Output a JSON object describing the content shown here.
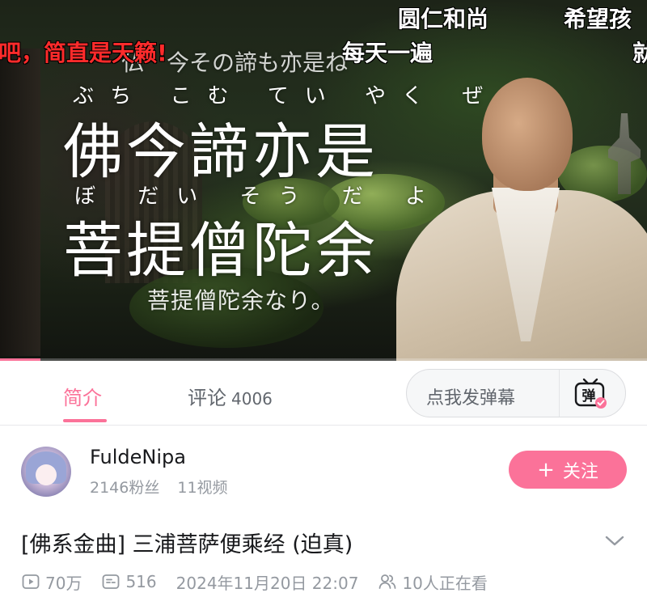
{
  "danmaku": {
    "items": [
      "圆仁和尚",
      "希望孩",
      "吧，简直是天籁!",
      "每天一遍",
      "就"
    ],
    "highlight_color": "#ff2b2b"
  },
  "video_frame": {
    "lyric_prev": "仏　今その諦も亦是ね",
    "ruby_line1": "ぶち こむ てい やく ぜ",
    "lyric_line1": "佛今諦亦是",
    "ruby_line2": "ぼ だい そう だ よ",
    "lyric_line2": "菩提僧陀余",
    "lyric_sub": "菩提僧陀余なり。"
  },
  "tabs": {
    "intro_label": "简介",
    "comments_label": "评论",
    "comments_count": "4006",
    "danmaku_placeholder": "点我发弹幕",
    "danmaku_toggle_icon": "danmaku-toggle-icon"
  },
  "uploader": {
    "name": "FuldeNipa",
    "followers": "2146粉丝",
    "videos": "11视频",
    "follow_label": "关注",
    "follow_plus": "+"
  },
  "video": {
    "title": "[佛系金曲] 三浦菩萨便乘经 (迫真)",
    "views": "70万",
    "danmaku_count": "516",
    "published": "2024年11月20日 22:07",
    "watching": "10人正在看"
  },
  "colors": {
    "accent": "#fb7299",
    "text_primary": "#18191c",
    "text_secondary": "#9499a0"
  }
}
